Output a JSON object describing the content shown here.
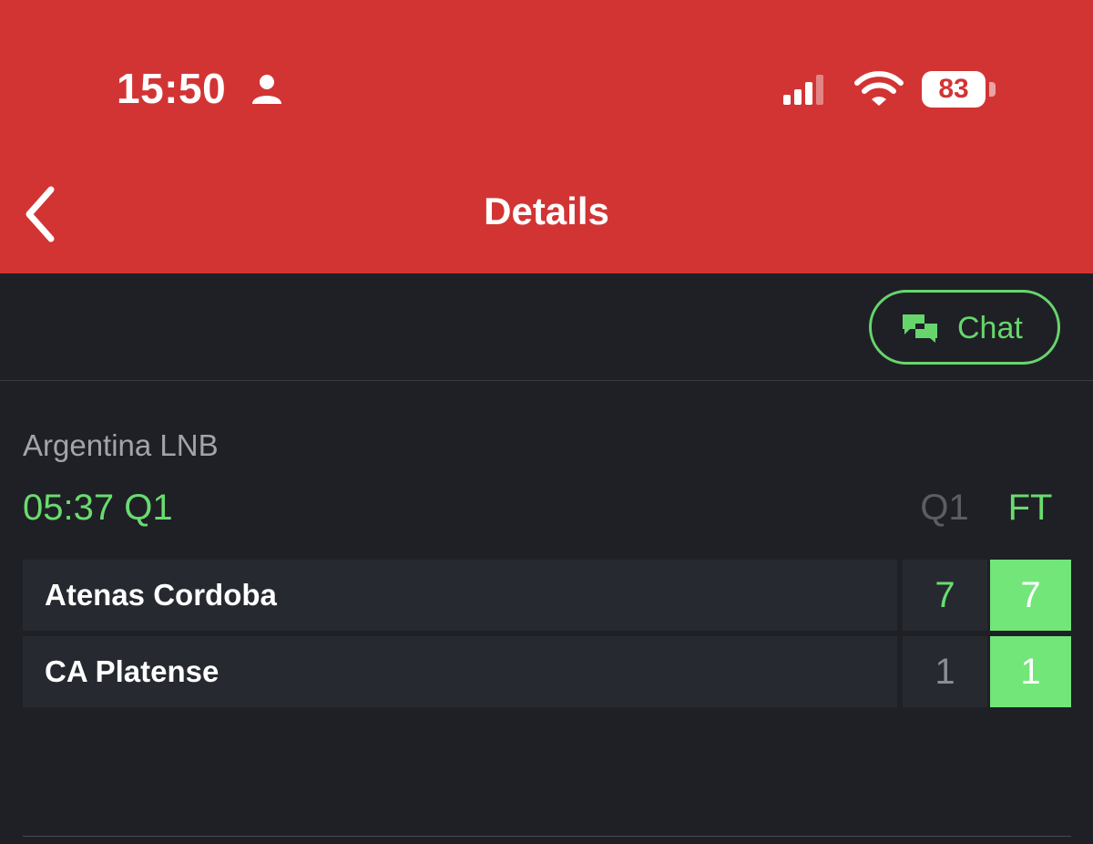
{
  "status_bar": {
    "time": "15:50",
    "battery": "83",
    "icons": [
      "person-icon",
      "signal-icon",
      "wifi-icon",
      "battery-icon"
    ]
  },
  "nav": {
    "title": "Details",
    "back_icon": "chevron-left-icon"
  },
  "toolbar": {
    "chat_label": "Chat",
    "chat_icon": "chat-bubbles-icon"
  },
  "match": {
    "league": "Argentina LNB",
    "clock": "05:37 Q1",
    "columns": [
      "Q1",
      "FT"
    ],
    "teams": [
      {
        "name": "Atenas Cordoba",
        "q1": "7",
        "ft": "7"
      },
      {
        "name": "CA Platense",
        "q1": "1",
        "ft": "1"
      }
    ]
  },
  "colors": {
    "header": "#d23434",
    "background": "#1f2025",
    "accent_green": "#69dc6f",
    "ft_cell": "#72e679",
    "row_bg": "#272930"
  }
}
